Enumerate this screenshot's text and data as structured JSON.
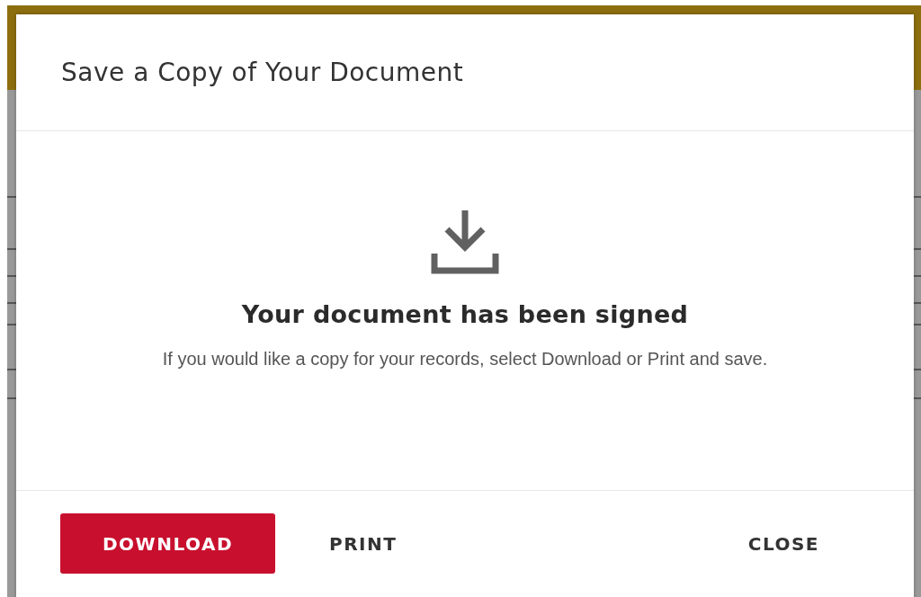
{
  "dialog": {
    "title": "Save a Copy of Your Document",
    "heading": "Your document has been signed",
    "message": "If you would like a copy for your records, select Download or Print and save.",
    "buttons": [
      {
        "label": "DOWNLOAD",
        "kind": "primary"
      },
      {
        "label": "PRINT",
        "kind": "text"
      },
      {
        "label": "CLOSE",
        "kind": "text"
      }
    ]
  }
}
